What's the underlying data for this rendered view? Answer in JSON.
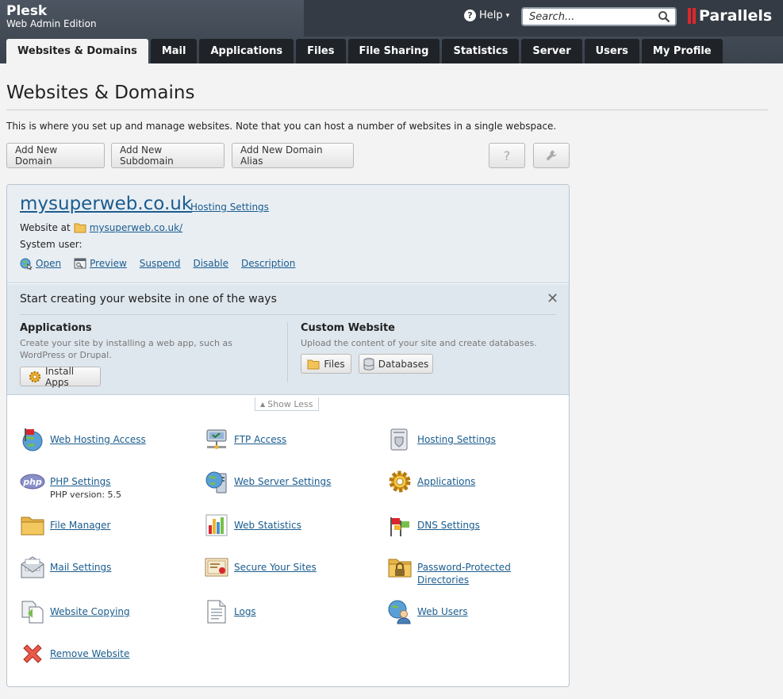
{
  "app": {
    "name": "Plesk",
    "edition": "Web Admin Edition",
    "help_label": "Help",
    "search_placeholder": "Search...",
    "logo_text": "Parallels",
    "accent": "#e0262c"
  },
  "tabs": [
    {
      "label": "Websites & Domains",
      "active": true
    },
    {
      "label": "Mail"
    },
    {
      "label": "Applications"
    },
    {
      "label": "Files"
    },
    {
      "label": "File Sharing"
    },
    {
      "label": "Statistics"
    },
    {
      "label": "Server"
    },
    {
      "label": "Users"
    },
    {
      "label": "My Profile"
    }
  ],
  "page": {
    "title": "Websites & Domains",
    "intro": "This is where you set up and manage websites. Note that you can host a number of websites in a single webspace.",
    "buttons": {
      "add_domain": "Add New Domain",
      "add_subdomain": "Add New Subdomain",
      "add_alias": "Add New Domain Alias",
      "help_icon": "?"
    }
  },
  "domain": {
    "name": "mysuperweb.co.uk",
    "hosting_settings": "Hosting Settings",
    "website_at_label": "Website at",
    "website_url": "mysuperweb.co.uk/",
    "system_user_label": "System user:",
    "actions": {
      "open": "Open",
      "preview": "Preview",
      "suspend": "Suspend",
      "disable": "Disable",
      "description": "Description"
    }
  },
  "start": {
    "title": "Start creating your website in one of the ways",
    "close": "✕",
    "apps_title": "Applications",
    "apps_desc": "Create your site by installing a web app, such as WordPress or Drupal.",
    "install_apps": "Install Apps",
    "custom_title": "Custom Website",
    "custom_desc": "Upload the content of your site and create databases.",
    "files": "Files",
    "databases": "Databases",
    "show_less": "Show Less"
  },
  "tools": {
    "web_hosting_access": "Web Hosting Access",
    "ftp_access": "FTP Access",
    "hosting_settings": "Hosting Settings",
    "php_settings": "PHP Settings",
    "php_version": "PHP version: 5.5",
    "web_server_settings": "Web Server Settings",
    "applications": "Applications",
    "file_manager": "File Manager",
    "web_statistics": "Web Statistics",
    "dns_settings": "DNS Settings",
    "mail_settings": "Mail Settings",
    "secure_sites": "Secure Your Sites",
    "password_dirs_1": "Password-Protected",
    "password_dirs_2": "Directories",
    "website_copying": "Website Copying",
    "logs": "Logs",
    "web_users": "Web Users",
    "remove_website": "Remove Website"
  }
}
